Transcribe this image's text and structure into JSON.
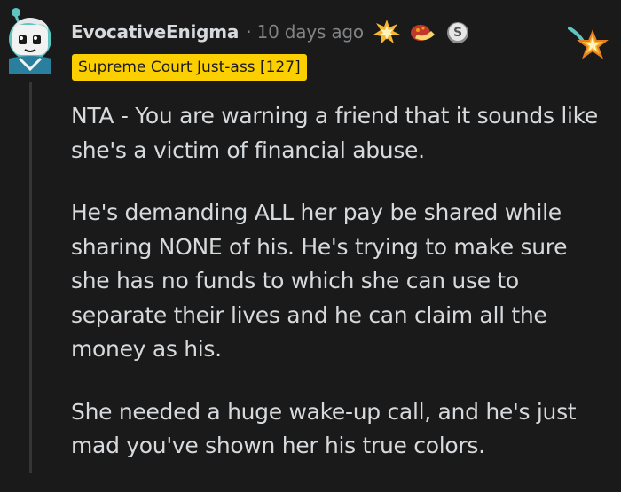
{
  "comment": {
    "username": "EvocativeEnigma",
    "separator": "·",
    "timestamp": "10 days ago",
    "flair": "Supreme Court Just-ass [127]",
    "awards": [
      "explosion-award-icon",
      "food-award-icon",
      "silver-coin-award-icon"
    ],
    "paragraphs": [
      "NTA - You are warning a friend that it sounds like she's a victim of financial abuse.",
      "He's demanding ALL her pay be shared while sharing NONE of his. He's trying to make sure she has no funds to which she can use to separate their lives and he can claim all the money as his.",
      "She needed a huge wake-up call, and he's just mad you've shown her his true colors."
    ]
  },
  "colors": {
    "background": "#1a1a1b",
    "text": "#d7dadc",
    "meta": "#818384",
    "flair_bg": "#fcd000",
    "thread_line": "#343536"
  }
}
